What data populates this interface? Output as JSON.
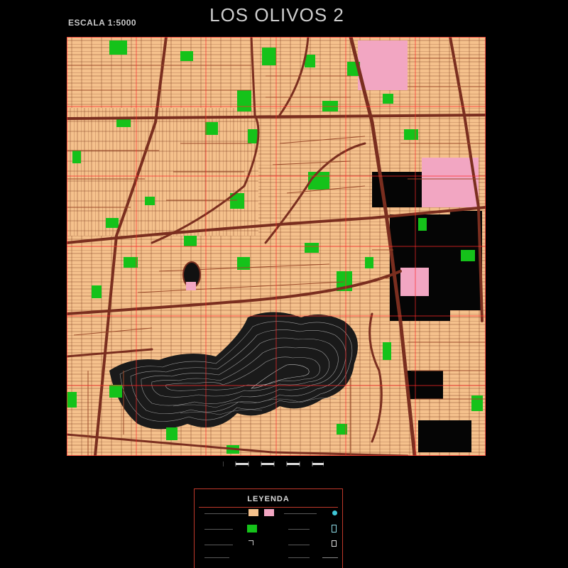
{
  "title": "LOS OLIVOS 2",
  "scale_text": "ESCALA 1:5000",
  "legend": {
    "title": "LEYENDA"
  },
  "colors": {
    "background": "#000000",
    "block": "#f5c18c",
    "block_edge": "#7a3a22",
    "park": "#15c21a",
    "commercial": "#f2a6c2",
    "road": "#7a2e1f",
    "grid": "#ff2a2a",
    "contour": "#9a9a9a",
    "legend_border": "#c0392b"
  },
  "map_features": {
    "road_network": "avenues and streets in dark red",
    "parks": "green areas",
    "hills": "contour lines in the southern zone",
    "commercial_zones": "pink areas in the east"
  },
  "icons": [
    "scale-bar",
    "legend-swatch-block",
    "legend-swatch-commercial",
    "legend-swatch-park",
    "legend-symbol-circle",
    "legend-symbol-square",
    "legend-line-sample"
  ]
}
